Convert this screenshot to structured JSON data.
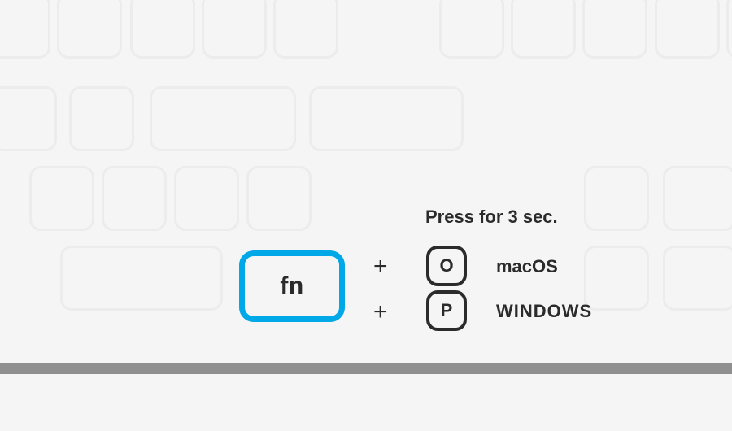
{
  "instruction": "Press for 3 sec.",
  "fn_key": {
    "label": "fn"
  },
  "combos": [
    {
      "plus": "+",
      "key": "O",
      "os": "macOS"
    },
    {
      "plus": "+",
      "key": "P",
      "os": "WINDOWS"
    }
  ]
}
